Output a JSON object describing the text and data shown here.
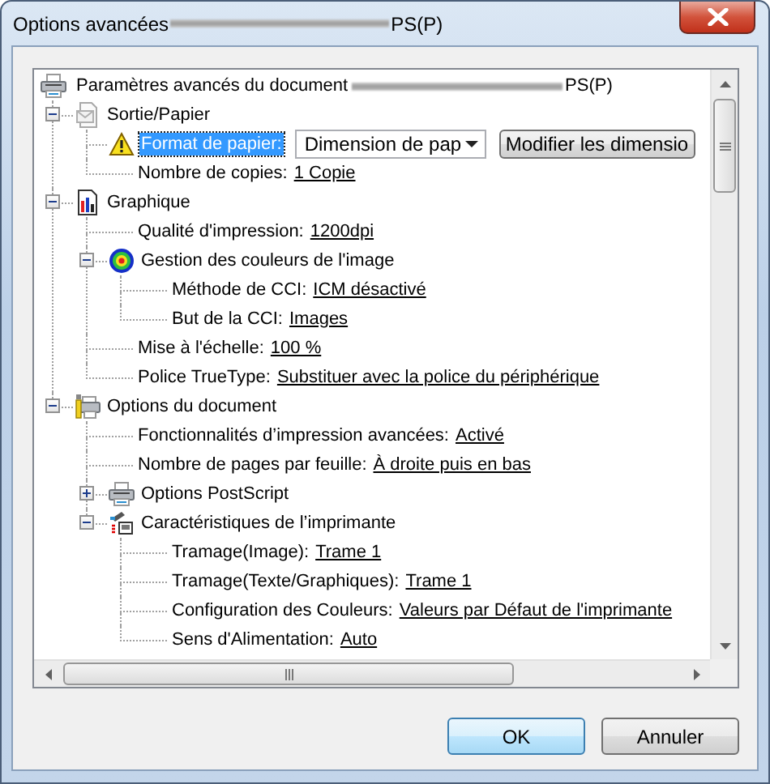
{
  "window": {
    "title": "Options avancées",
    "title_redacted": true,
    "title_suffix": "PS(P)"
  },
  "tree": {
    "kind": "root",
    "label": "Paramètres avancés du document",
    "redacted": true,
    "suffix": "PS(P)",
    "selected": false,
    "children": [
      {
        "kind": "output",
        "label": "Sortie/Papier",
        "selected": false,
        "expanded": true,
        "children": [
          {
            "kind": "paper_setting",
            "label": "Format de papier:",
            "selected": true,
            "dropdown": "Dimension de pap",
            "button": "Modifier les dimensio"
          },
          {
            "kind": "setting",
            "label": "Nombre de copies:",
            "value": "1 Copie",
            "selected": false
          }
        ]
      },
      {
        "kind": "graphics",
        "label": "Graphique",
        "selected": false,
        "expanded": true,
        "children": [
          {
            "kind": "setting",
            "label": "Qualité d'impression:",
            "value": "1200dpi",
            "selected": false
          },
          {
            "kind": "color",
            "label": "Gestion des couleurs de l'image",
            "selected": false,
            "expanded": true,
            "children": [
              {
                "kind": "setting",
                "label": "Méthode de CCI:",
                "value": "ICM désactivé",
                "selected": false
              },
              {
                "kind": "setting",
                "label": "But de la CCI:",
                "value": "Images",
                "selected": false
              }
            ]
          },
          {
            "kind": "setting",
            "label": "Mise à l'échelle:",
            "value": "100 %",
            "selected": false
          },
          {
            "kind": "setting",
            "label": "Police TrueType:",
            "value": "Substituer avec la police du périphérique",
            "selected": false
          }
        ]
      },
      {
        "kind": "options",
        "label": "Options du document",
        "selected": false,
        "expanded": true,
        "children": [
          {
            "kind": "setting",
            "label": "Fonctionnalités d’impression avancées:",
            "value": "Activé",
            "selected": false
          },
          {
            "kind": "setting",
            "label": "Nombre de pages par feuille:",
            "value": "À droite puis en bas",
            "selected": false
          },
          {
            "kind": "postscript",
            "label": "Options PostScript",
            "selected": false,
            "expanded": false
          },
          {
            "kind": "features",
            "label": "Caractéristiques de l’imprimante",
            "selected": false,
            "expanded": true,
            "children": [
              {
                "kind": "setting",
                "label": "Tramage(Image):",
                "value": "Trame 1",
                "selected": false
              },
              {
                "kind": "setting",
                "label": "Tramage(Texte/Graphiques):",
                "value": "Trame 1",
                "selected": false
              },
              {
                "kind": "setting",
                "label": "Configuration des Couleurs:",
                "value": "Valeurs par Défaut de l'imprimante",
                "selected": false
              },
              {
                "kind": "setting",
                "label": "Sens d'Alimentation:",
                "value": "Auto",
                "selected": false
              }
            ]
          }
        ]
      }
    ]
  },
  "buttons": [
    {
      "label": "OK",
      "default": true
    },
    {
      "label": "Annuler",
      "default": false
    }
  ]
}
